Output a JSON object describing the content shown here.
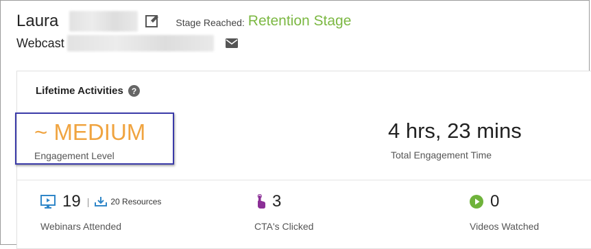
{
  "header": {
    "first_name": "Laura",
    "stage_label": "Stage Reached:",
    "stage_value": "Retention Stage",
    "type_label": "Webcast"
  },
  "icons": {
    "edit": "edit-icon",
    "mail": "mail-icon",
    "help": "help-icon",
    "monitor": "monitor-icon",
    "download": "download-icon",
    "pointer": "pointer-icon",
    "play": "play-icon"
  },
  "lifetime": {
    "title": "Lifetime Activities",
    "engagement_level": "~ MEDIUM",
    "engagement_label": "Engagement Level",
    "total_time": "4 hrs, 23 mins",
    "total_time_label": "Total Engagement Time"
  },
  "stats": {
    "webinars": {
      "value": "19",
      "separator": "|",
      "resources": "20 Resources",
      "label": "Webinars Attended"
    },
    "ctas": {
      "value": "3",
      "label": "CTA's Clicked"
    },
    "videos": {
      "value": "0",
      "label": "Videos Watched"
    }
  },
  "colors": {
    "stage": "#7cb843",
    "engagement": "#f0a440",
    "highlight_border": "#3a3aa8",
    "webinar_icon": "#2f86c8",
    "cta_icon": "#8b2f96",
    "video_icon": "#6fb33b"
  }
}
